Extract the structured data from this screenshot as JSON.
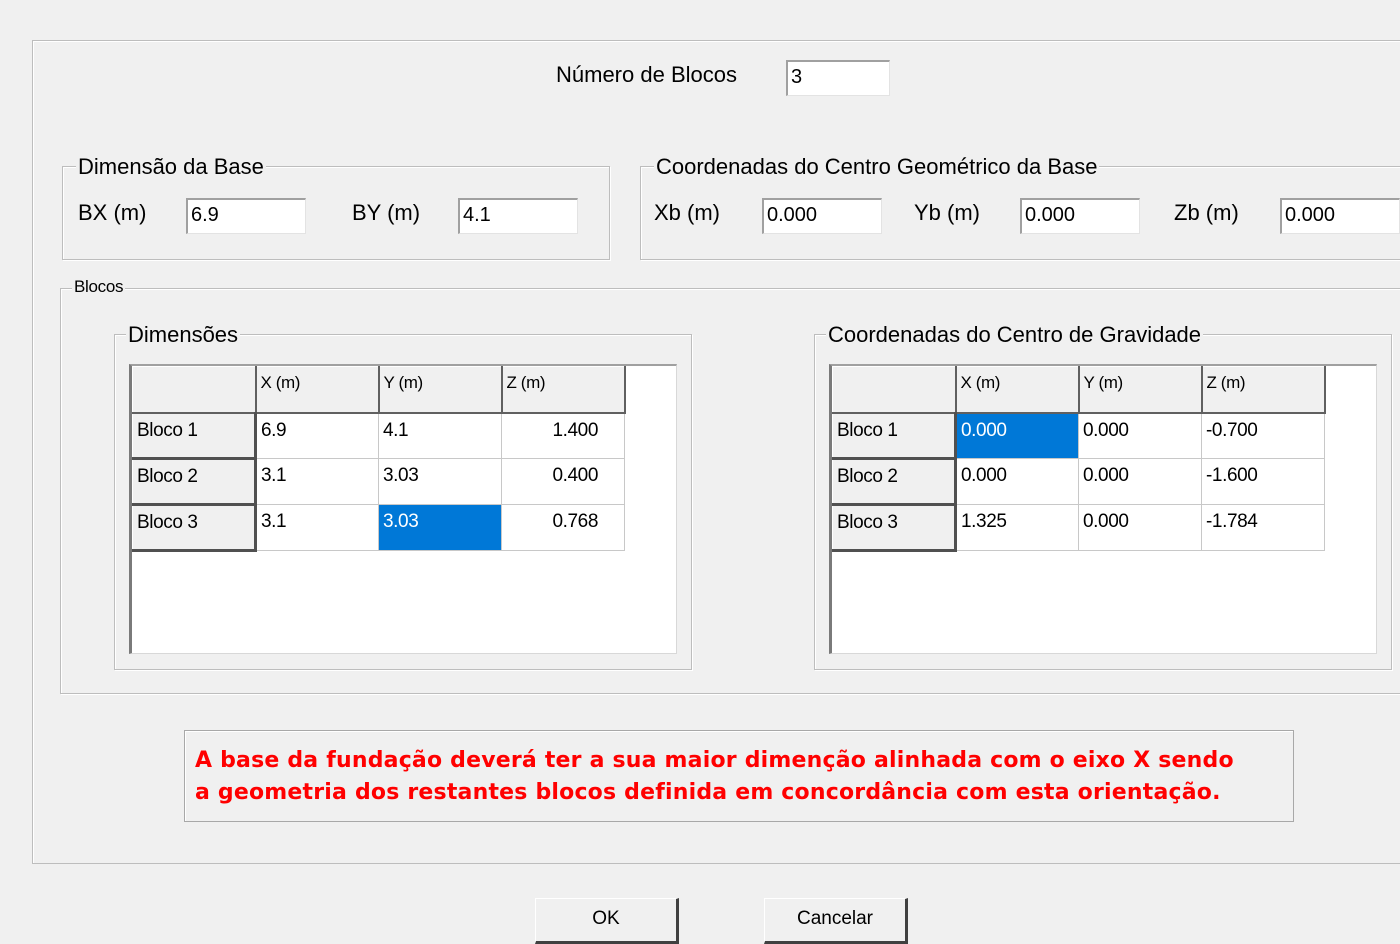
{
  "num_blocks": {
    "label": "Número de Blocos",
    "value": "3"
  },
  "base_dims": {
    "legend": "Dimensão da Base",
    "bx_label": "BX (m)",
    "bx_value": "6.9",
    "by_label": "BY (m)",
    "by_value": "4.1"
  },
  "base_center": {
    "legend": "Coordenadas do Centro Geométrico da Base",
    "xb_label": "Xb (m)",
    "xb_value": "0.000",
    "yb_label": "Yb (m)",
    "yb_value": "0.000",
    "zb_label": "Zb (m)",
    "zb_value": "0.000"
  },
  "blocks": {
    "legend": "Blocos",
    "dimensions": {
      "legend": "Dimensões",
      "headers": [
        "",
        "X (m)",
        "Y (m)",
        "Z (m)"
      ],
      "rows": [
        [
          "Bloco 1",
          "6.9",
          "4.1",
          "1.400"
        ],
        [
          "Bloco 2",
          "3.1",
          "3.03",
          "0.400"
        ],
        [
          "Bloco 3",
          "3.1",
          "3.03",
          "0.768"
        ]
      ],
      "selected_cell": "Bloco 3 / Y (m)"
    },
    "gravity": {
      "legend": "Coordenadas do Centro de Gravidade",
      "headers": [
        "",
        "X (m)",
        "Y (m)",
        "Z (m)"
      ],
      "rows": [
        [
          "Bloco 1",
          "0.000",
          "0.000",
          "-0.700"
        ],
        [
          "Bloco 2",
          "0.000",
          "0.000",
          "-1.600"
        ],
        [
          "Bloco 3",
          "1.325",
          "0.000",
          "-1.784"
        ]
      ],
      "selected_cell": "Bloco 1 / X (m)"
    }
  },
  "warning": {
    "line1": "A base da fundação deverá ter a sua maior dimenção alinhada com o eixo X sendo",
    "line2": "a geometria dos restantes blocos definida em concordância com esta orientação.",
    "color": "#ff0000"
  },
  "buttons": {
    "ok": "OK",
    "cancel": "Cancelar"
  },
  "colors": {
    "selection": "#0078d7",
    "background": "#f0f0f0"
  }
}
